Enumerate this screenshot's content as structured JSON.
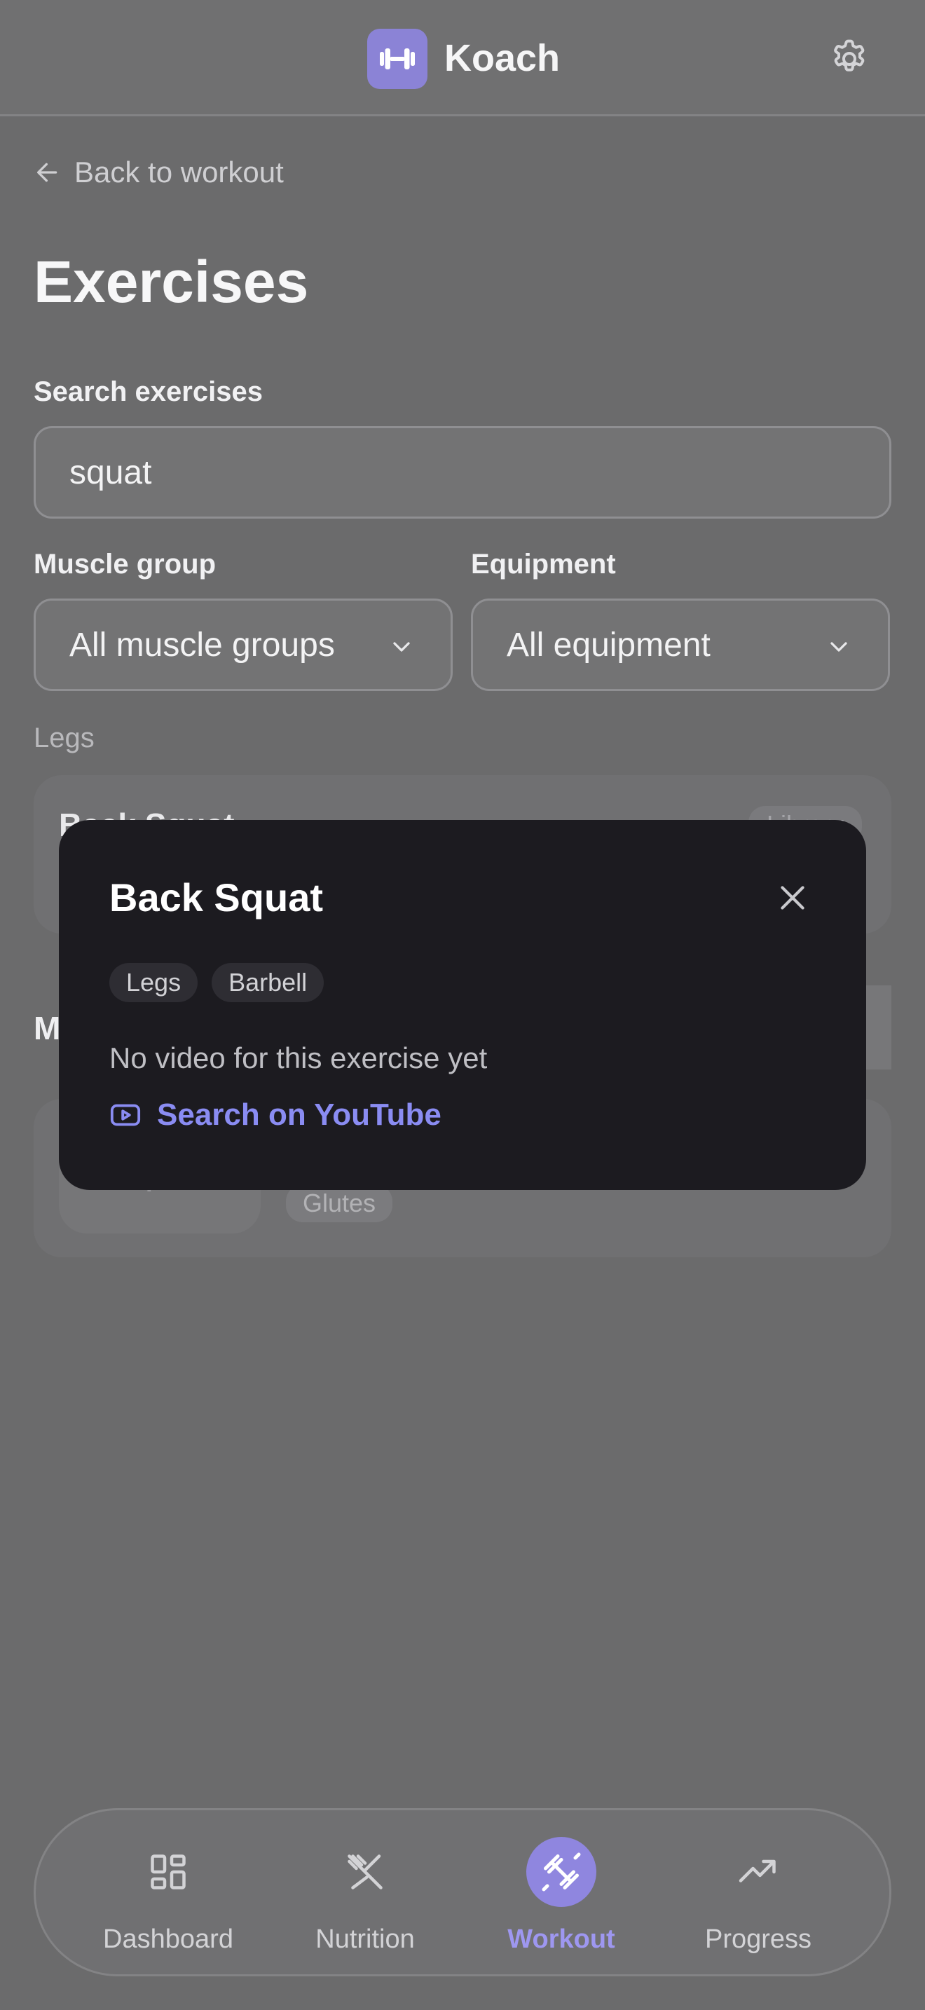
{
  "app": {
    "name": "Koach",
    "logo_icon": "dumbbell-icon",
    "accent": "#8b83d6"
  },
  "header": {
    "settings_icon": "gear-icon"
  },
  "nav_back": {
    "label": "Back to workout"
  },
  "page": {
    "title": "Exercises"
  },
  "search": {
    "label": "Search exercises",
    "value": "squat"
  },
  "filters": {
    "muscle": {
      "label": "Muscle group",
      "value": "All muscle groups"
    },
    "equipment": {
      "label": "Equipment",
      "value": "All equipment"
    }
  },
  "results": {
    "section": "Legs",
    "first_card": {
      "title": "Back Squat",
      "badge": "Library"
    },
    "second_section_initial": "M",
    "second_card": {
      "tag": "Glutes"
    }
  },
  "modal": {
    "title": "Back Squat",
    "tags": [
      "Legs",
      "Barbell"
    ],
    "message": "No video for this exercise yet",
    "link": "Search on YouTube"
  },
  "bottom_nav": [
    {
      "label": "Dashboard",
      "icon": "grid-icon"
    },
    {
      "label": "Nutrition",
      "icon": "fork-knife-icon"
    },
    {
      "label": "Workout",
      "icon": "dumbbell-icon",
      "active": true
    },
    {
      "label": "Progress",
      "icon": "trend-up-icon"
    }
  ]
}
